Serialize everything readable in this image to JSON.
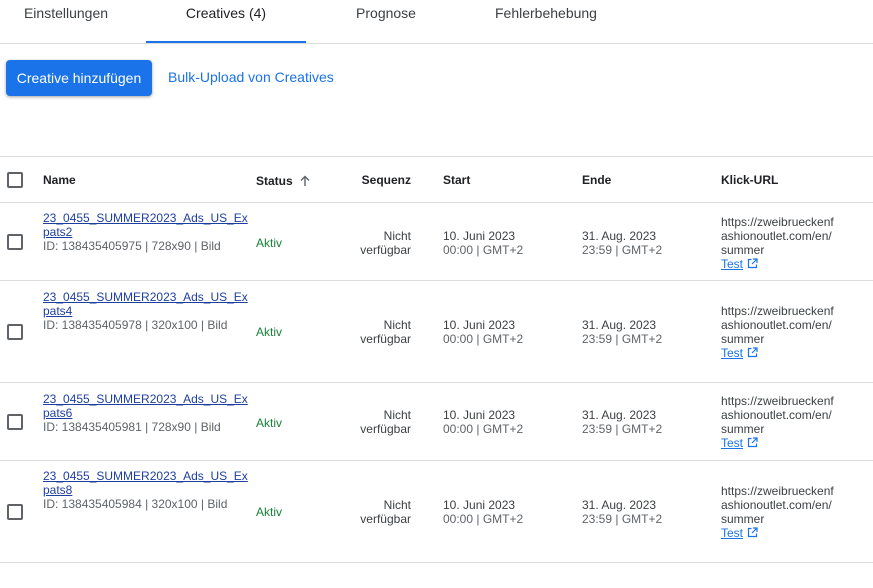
{
  "tabs": [
    {
      "label": "Einstellungen"
    },
    {
      "label": "Creatives (4)"
    },
    {
      "label": "Prognose"
    },
    {
      "label": "Fehlerbehebung"
    }
  ],
  "toolbar": {
    "add_label": "Creative hinzufügen",
    "bulk_label": "Bulk-Upload von Creatives"
  },
  "table": {
    "headers": {
      "name": "Name",
      "status": "Status",
      "sequence": "Sequenz",
      "start": "Start",
      "end": "Ende",
      "click_url": "Klick-URL"
    },
    "rows": [
      {
        "name_line1": "23_0455_SUMMER2023_Ads_US_Ex",
        "name_line2": "pats2",
        "meta": "ID: 138435405975 | 728x90 | Bild",
        "status": "Aktiv",
        "seq_line1": "Nicht",
        "seq_line2": "verfügbar",
        "start_line1": "10. Juni 2023",
        "start_line2": "00:00 | GMT+2",
        "end_line1": "31. Aug. 2023",
        "end_line2": "23:59 | GMT+2",
        "url_line1": "https://zweibrueckenf",
        "url_line2": "ashionoutlet.com/en/",
        "url_line3": "summer",
        "test": "Test"
      },
      {
        "name_line1": "23_0455_SUMMER2023_Ads_US_Ex",
        "name_line2": "pats4",
        "meta": "ID: 138435405978 | 320x100 | Bild",
        "status": "Aktiv",
        "seq_line1": "Nicht",
        "seq_line2": "verfügbar",
        "start_line1": "10. Juni 2023",
        "start_line2": "00:00 | GMT+2",
        "end_line1": "31. Aug. 2023",
        "end_line2": "23:59 | GMT+2",
        "url_line1": "https://zweibrueckenf",
        "url_line2": "ashionoutlet.com/en/",
        "url_line3": "summer",
        "test": "Test"
      },
      {
        "name_line1": "23_0455_SUMMER2023_Ads_US_Ex",
        "name_line2": "pats6",
        "meta": "ID: 138435405981 | 728x90 | Bild",
        "status": "Aktiv",
        "seq_line1": "Nicht",
        "seq_line2": "verfügbar",
        "start_line1": "10. Juni 2023",
        "start_line2": "00:00 | GMT+2",
        "end_line1": "31. Aug. 2023",
        "end_line2": "23:59 | GMT+2",
        "url_line1": "https://zweibrueckenf",
        "url_line2": "ashionoutlet.com/en/",
        "url_line3": "summer",
        "test": "Test"
      },
      {
        "name_line1": "23_0455_SUMMER2023_Ads_US_Ex",
        "name_line2": "pats8",
        "meta": "ID: 138435405984 | 320x100 | Bild",
        "status": "Aktiv",
        "seq_line1": "Nicht",
        "seq_line2": "verfügbar",
        "start_line1": "10. Juni 2023",
        "start_line2": "00:00 | GMT+2",
        "end_line1": "31. Aug. 2023",
        "end_line2": "23:59 | GMT+2",
        "url_line1": "https://zweibrueckenf",
        "url_line2": "ashionoutlet.com/en/",
        "url_line3": "summer",
        "test": "Test"
      }
    ]
  }
}
